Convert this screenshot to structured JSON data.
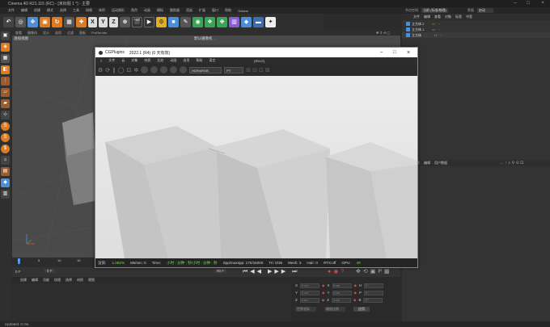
{
  "app": {
    "title": "Cinema 4D R21.115 (RC) - [未标题 1 *] - 主要",
    "node_label": "节点空间",
    "mode_label": "当前 (标准/物理)",
    "layout_label": "界面",
    "layout_value": "启动"
  },
  "menubar": {
    "items": [
      "文件",
      "编辑",
      "创建",
      "模式",
      "选择",
      "工具",
      "网格",
      "体积",
      "运动图形",
      "角色",
      "动画",
      "模拟",
      "跟踪器",
      "渲染",
      "扩展",
      "窗口",
      "帮助",
      "Octane"
    ]
  },
  "toolbar": {
    "axis_labels": [
      "X",
      "Y",
      "Z"
    ]
  },
  "viewport": {
    "menu": [
      "查看",
      "摄像机",
      "显示",
      "选项",
      "过滤",
      "面板",
      "ProRender"
    ],
    "name": "透视视图",
    "camera_label": "默认摄像机",
    "camera_dot": "."
  },
  "object_manager": {
    "menu": [
      "文件",
      "编辑",
      "查看",
      "对象",
      "标签",
      "书签"
    ],
    "objects": [
      "立方体.2",
      "立方体.1",
      "立方体"
    ]
  },
  "attr_manager": {
    "menu": [
      "模式",
      "编辑",
      "用户数据"
    ]
  },
  "dialog": {
    "title": "CGPlugins",
    "subtitle": "2022.1 (R4) (0 天有效)",
    "menu": [
      "文件",
      "云",
      "对象",
      "材质",
      "比较",
      "动画",
      "选项",
      "帮助",
      "语言"
    ],
    "menu_extra": "[RELE]",
    "colorspace": "HDR/sRGB",
    "mode": "PT",
    "status": {
      "progress_label": "渲染:",
      "progress": "1.062%",
      "ms_label": "Ms/sec: 0",
      "time_label": "Time:",
      "time_value": "小时 : 分钟 : 秒/小时 : 分钟 : 秒",
      "spp": "Spp/maxspp: 170/16000",
      "tri": "Tri: 0/36",
      "mesh": "Mesh: 3",
      "hair": "Hair: 0",
      "rtx": "RTX:off",
      "gpu_label": "GPU:",
      "gpu_value": "49"
    }
  },
  "timeline": {
    "ticks": [
      "0",
      "5",
      "10",
      "15"
    ],
    "frame_start": "0 F",
    "frame_cur": "0 F",
    "frame_end": "90 F"
  },
  "materials": {
    "menu": [
      "创建",
      "编辑",
      "功能",
      "纹理",
      "选择",
      "材质",
      "视图"
    ]
  },
  "coords": {
    "rows": [
      {
        "a": "X",
        "av": "0 cm",
        "b": "X",
        "bv": "0 cm",
        "c": "H",
        "cv": "0 °"
      },
      {
        "a": "Y",
        "av": "0 cm",
        "b": "Y",
        "bv": "0 cm",
        "c": "P",
        "cv": "0 °"
      },
      {
        "a": "Z",
        "av": "0 cm",
        "b": "Z",
        "bv": "0 cm",
        "c": "B",
        "cv": "0 °"
      }
    ],
    "space": "世界坐标",
    "scale": "缩放比例",
    "apply": "应用"
  },
  "statusline": "Updated: 0 ms.",
  "colors": {
    "accent_orange": "#e07a1f",
    "accent_blue": "#4a8fd8",
    "gpu_green": "#7bd65a"
  }
}
